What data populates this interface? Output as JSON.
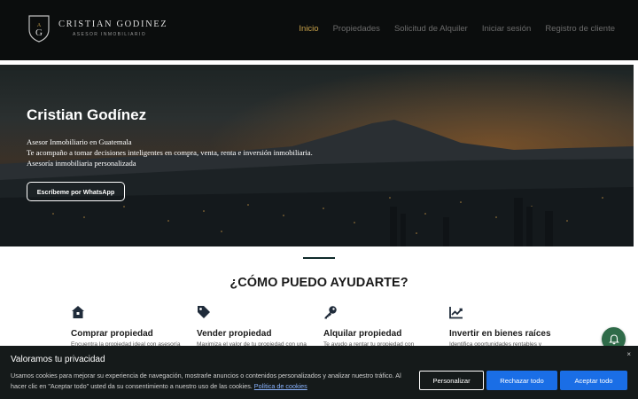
{
  "brand": {
    "name": "CRISTIAN GODINEZ",
    "tagline": "ASESOR INMOBILIARIO",
    "accent_color": "#c9a24a"
  },
  "nav": {
    "items": [
      {
        "label": "Inicio",
        "active": true
      },
      {
        "label": "Propiedades",
        "active": false
      },
      {
        "label": "Solicitud de Alquiler",
        "active": false
      },
      {
        "label": "Iniciar sesión",
        "active": false
      },
      {
        "label": "Registro de cliente",
        "active": false
      }
    ]
  },
  "hero": {
    "title": "Cristian Godínez",
    "lines": [
      "Asesor Inmobiliario en Guatemala",
      "Te acompaño a tomar decisiones inteligentes en compra, venta, renta e inversión inmobiliaria.",
      "Asesoría inmobiliaria personalizada"
    ],
    "button_label": "Escríbeme por WhatsApp"
  },
  "services": {
    "heading": "¿CÓMO PUEDO AYUDARTE?",
    "items": [
      {
        "icon": "house-icon",
        "title": "Comprar propiedad",
        "desc": "Encuentra la propiedad ideal con asesoría"
      },
      {
        "icon": "tag-icon",
        "title": "Vender propiedad",
        "desc": "Maximiza el valor de tu propiedad con una"
      },
      {
        "icon": "key-icon",
        "title": "Alquilar propiedad",
        "desc": "Te ayudo a rentar tu propiedad con"
      },
      {
        "icon": "chart-line-icon",
        "title": "Invertir en bienes raíces",
        "desc": "Identifica oportunidades rentables y"
      }
    ]
  },
  "chat": {
    "icon": "bell-icon",
    "color": "#2f6b49"
  },
  "cookie": {
    "title": "Valoramos tu privacidad",
    "text": "Usamos cookies para mejorar su experiencia de navegación, mostrarle anuncios o contenidos personalizados y analizar nuestro tráfico. Al hacer clic en \"Aceptar todo\" usted da su consentimiento a nuestro uso de las cookies.",
    "link_label": "Política de cookies",
    "close": "×",
    "buttons": {
      "customize": "Personalizar",
      "reject": "Rechazar todo",
      "accept": "Aceptar todo"
    },
    "button_color": "#1a6ee6"
  }
}
